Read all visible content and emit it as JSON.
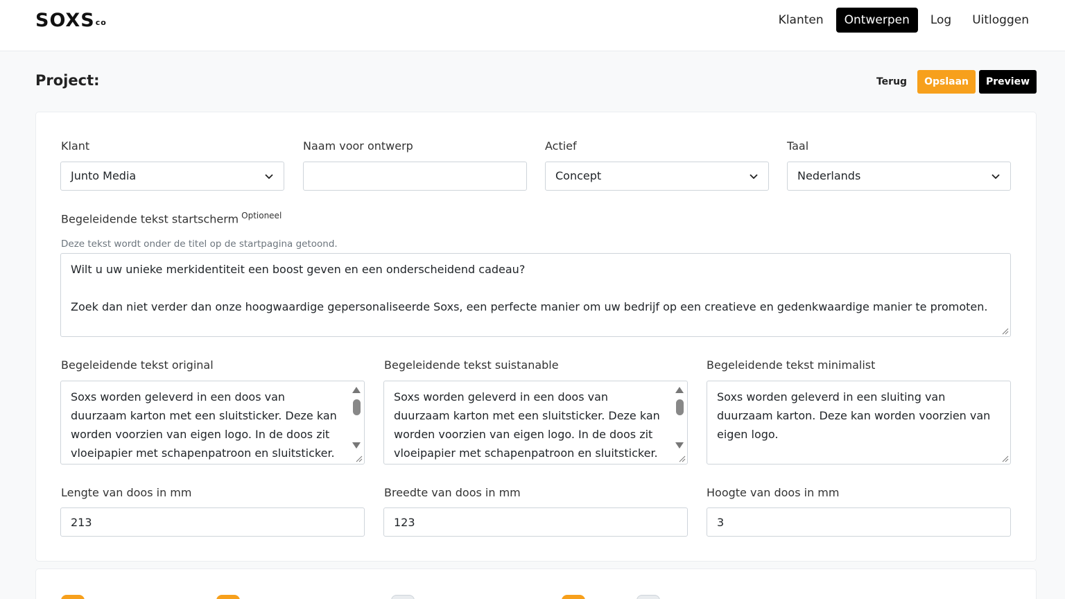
{
  "app": {
    "logo_text": "SOXS",
    "logo_suffix": "co"
  },
  "nav": {
    "items": [
      {
        "label": "Klanten",
        "active": false
      },
      {
        "label": "Ontwerpen",
        "active": true
      },
      {
        "label": "Log",
        "active": false
      },
      {
        "label": "Uitloggen",
        "active": false
      }
    ]
  },
  "header": {
    "title": "Project:",
    "back_label": "Terug",
    "save_label": "Opslaan",
    "preview_label": "Preview"
  },
  "form": {
    "klant": {
      "label": "Klant",
      "value": "Junto Media"
    },
    "naam": {
      "label": "Naam voor ontwerp",
      "value": ""
    },
    "actief": {
      "label": "Actief",
      "value": "Concept"
    },
    "taal": {
      "label": "Taal",
      "value": "Nederlands"
    },
    "startscherm": {
      "label": "Begeleidende tekst startscherm",
      "optional": "Optioneel",
      "hint": "Deze tekst wordt onder de titel op de startpagina getoond.",
      "line1": "Wilt u uw unieke merkidentiteit een boost geven en een onderscheidend cadeau?",
      "line2": "Zoek dan niet verder dan onze hoogwaardige gepersonaliseerde Soxs, een perfecte manier om uw bedrijf op een creatieve en gedenkwaardige manier te promoten."
    },
    "original": {
      "label": "Begeleidende tekst original",
      "value": "Soxs worden geleverd in een doos van duurzaam karton met een sluitsticker. Deze kan worden voorzien van eigen logo. In de doos zit vloeipapier met schapenpatroon en sluitsticker."
    },
    "sustainable": {
      "label": "Begeleidende tekst suistanable",
      "value": "Soxs worden geleverd in een doos van duurzaam karton met een sluitsticker. Deze kan worden voorzien van eigen logo. In de doos zit vloeipapier met schapenpatroon en sluitsticker."
    },
    "minimalist": {
      "label": "Begeleidende tekst minimalist",
      "value": "Soxs worden geleverd in een sluiting van duurzaam karton. Deze kan worden voorzien van eigen logo."
    },
    "lengte": {
      "label": "Lengte van doos in mm",
      "value": "213"
    },
    "breedte": {
      "label": "Breedte van doos in mm",
      "value": "123"
    },
    "hoogte": {
      "label": "Hoogte van doos in mm",
      "value": "3"
    }
  },
  "colors": {
    "accent": "#f7a01c",
    "primary": "#000000",
    "toggle_off": "#e9ecef"
  }
}
